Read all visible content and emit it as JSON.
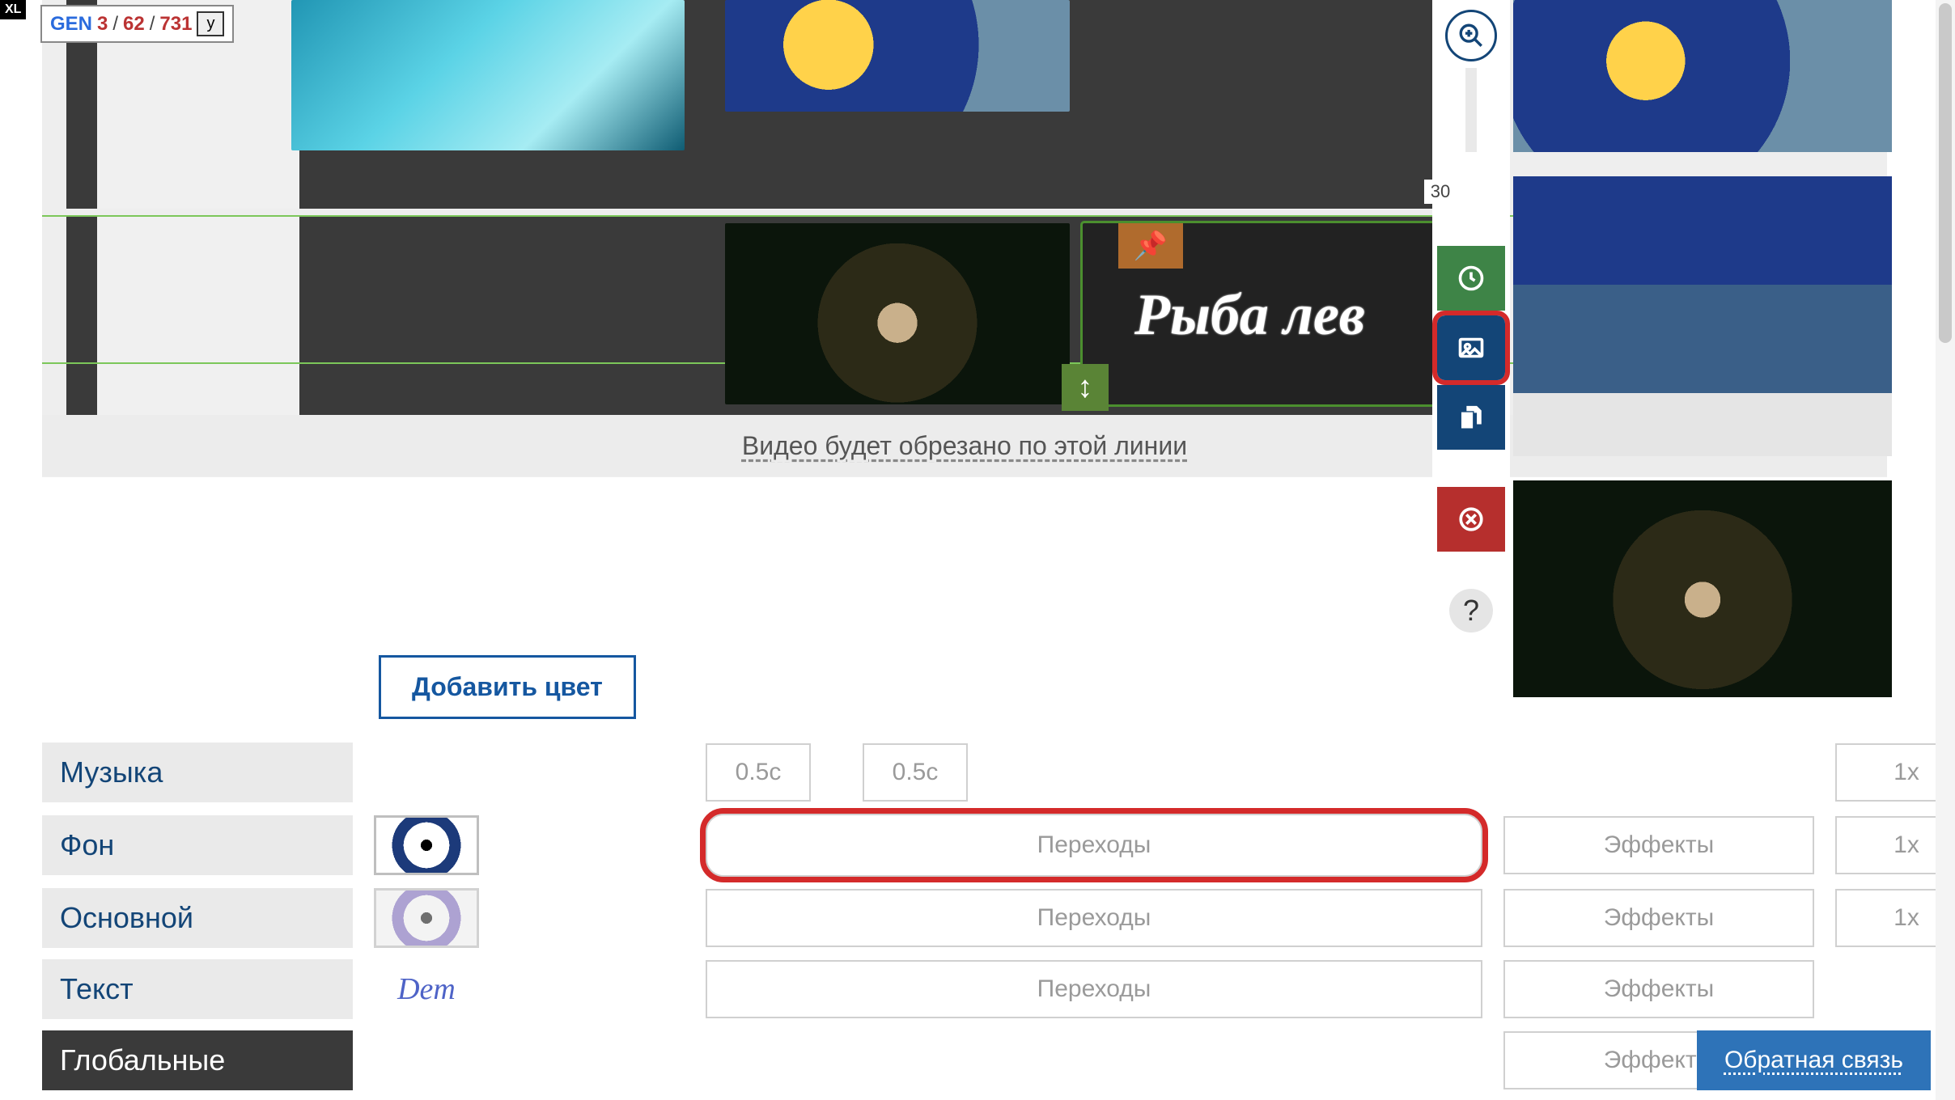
{
  "badge": {
    "xl": "XL",
    "gen": "GEN",
    "a": "3",
    "b": "62",
    "c": "731",
    "y": "y"
  },
  "canvas": {
    "text_overlay": "Рыба лев",
    "trim_message": "Видео будет обрезано по этой линии"
  },
  "tools": {
    "zoom_value": "30",
    "zoom_in_icon": "zoom-in-icon",
    "time_icon": "clock-icon",
    "image_icon": "image-icon",
    "copy_icon": "duplicate-icon",
    "delete_icon": "delete-icon",
    "help_icon": "help-icon"
  },
  "add_color_label": "Добавить цвет",
  "durations": {
    "d1": "0.5с",
    "d2": "0.5с"
  },
  "layers": {
    "music": {
      "label": "Музыка"
    },
    "bg": {
      "label": "Фон",
      "transitions": "Переходы",
      "effects": "Эффекты",
      "speed": "1x"
    },
    "main": {
      "label": "Основной",
      "transitions": "Переходы",
      "effects": "Эффекты",
      "speed": "1x"
    },
    "text": {
      "label": "Текст",
      "dem": "Dem",
      "transitions": "Переходы",
      "effects": "Эффекты"
    },
    "global": {
      "label": "Глобальные",
      "effects": "Эффекты"
    }
  },
  "top_speed": "1x",
  "feedback_label": "Обратная связь"
}
